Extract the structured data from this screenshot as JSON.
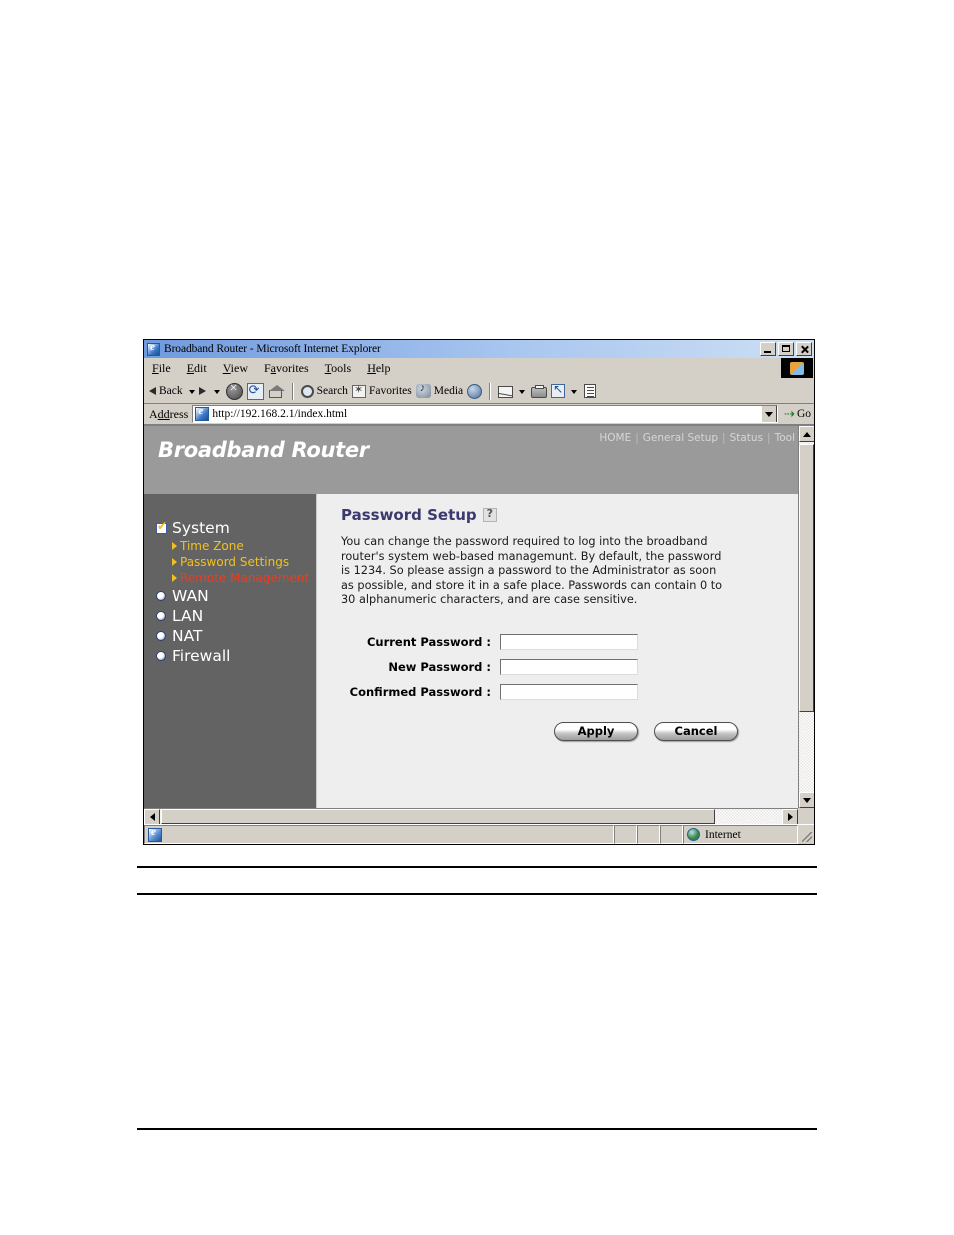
{
  "window": {
    "title": "Broadband Router - Microsoft Internet Explorer",
    "title_icon": "ie-logo-icon",
    "controls": {
      "minimize": "Minimize",
      "maximize": "Maximize",
      "close": "Close"
    }
  },
  "menu": {
    "items": [
      {
        "label": "File",
        "accel": "F"
      },
      {
        "label": "Edit",
        "accel": "E"
      },
      {
        "label": "View",
        "accel": "V"
      },
      {
        "label": "Favorites",
        "accel": "a"
      },
      {
        "label": "Tools",
        "accel": "T"
      },
      {
        "label": "Help",
        "accel": "H"
      }
    ]
  },
  "toolbar": {
    "back_label": "Back",
    "forward_label": "",
    "search_label": "Search",
    "favorites_label": "Favorites",
    "media_label": "Media",
    "icons": [
      "back-arrow-icon",
      "forward-arrow-icon",
      "stop-icon",
      "refresh-icon",
      "home-icon",
      "search-icon",
      "favorites-icon",
      "media-icon",
      "history-icon",
      "mail-icon",
      "print-icon",
      "edit-icon",
      "discuss-icon"
    ]
  },
  "address": {
    "label": "Address",
    "url": "http://192.168.2.1/index.html",
    "go_label": "Go"
  },
  "site": {
    "brand": "Broadband Router",
    "nav": [
      {
        "label": "HOME"
      },
      {
        "label": "General Setup"
      },
      {
        "label": "Status"
      },
      {
        "label": "Tool"
      }
    ],
    "nav_separator": "|"
  },
  "sidebar": {
    "items": [
      {
        "label": "System",
        "type": "top",
        "bullet": "check"
      },
      {
        "label": "Time Zone",
        "type": "sub",
        "color": "yellow"
      },
      {
        "label": "Password Settings",
        "type": "sub",
        "color": "yellow"
      },
      {
        "label": "Remote Management",
        "type": "sub",
        "color": "red"
      },
      {
        "label": "WAN",
        "type": "top",
        "bullet": "dot"
      },
      {
        "label": "LAN",
        "type": "top",
        "bullet": "dot"
      },
      {
        "label": "NAT",
        "type": "top",
        "bullet": "dot"
      },
      {
        "label": "Firewall",
        "type": "top",
        "bullet": "dot"
      }
    ]
  },
  "content": {
    "title": "Password Setup",
    "help_icon": "help-question-icon",
    "description": "You can change the password required to log into the broadband router's system web-based managemunt. By default, the password is 1234. So please assign a password to the Administrator as soon as possible, and store it in a safe place. Passwords can contain 0 to 30 alphanumeric characters, and are case sensitive.",
    "fields": [
      {
        "label": "Current Password :",
        "value": "",
        "placeholder": ""
      },
      {
        "label": "New Password :",
        "value": "",
        "placeholder": ""
      },
      {
        "label": "Confirmed Password :",
        "value": "",
        "placeholder": ""
      }
    ],
    "buttons": {
      "apply": "Apply",
      "cancel": "Cancel"
    }
  },
  "status": {
    "message": "",
    "zone": "Internet",
    "zone_icon": "internet-globe-icon"
  },
  "colors": {
    "header_band": "#9a9a9a",
    "sidebar": "#636363",
    "content_bg": "#eeeeee",
    "title_accent": "#3a3a6e",
    "sub_link": "#f2c01e",
    "sub_link_alt": "#f23a1e",
    "chrome": "#d4d0c8"
  }
}
